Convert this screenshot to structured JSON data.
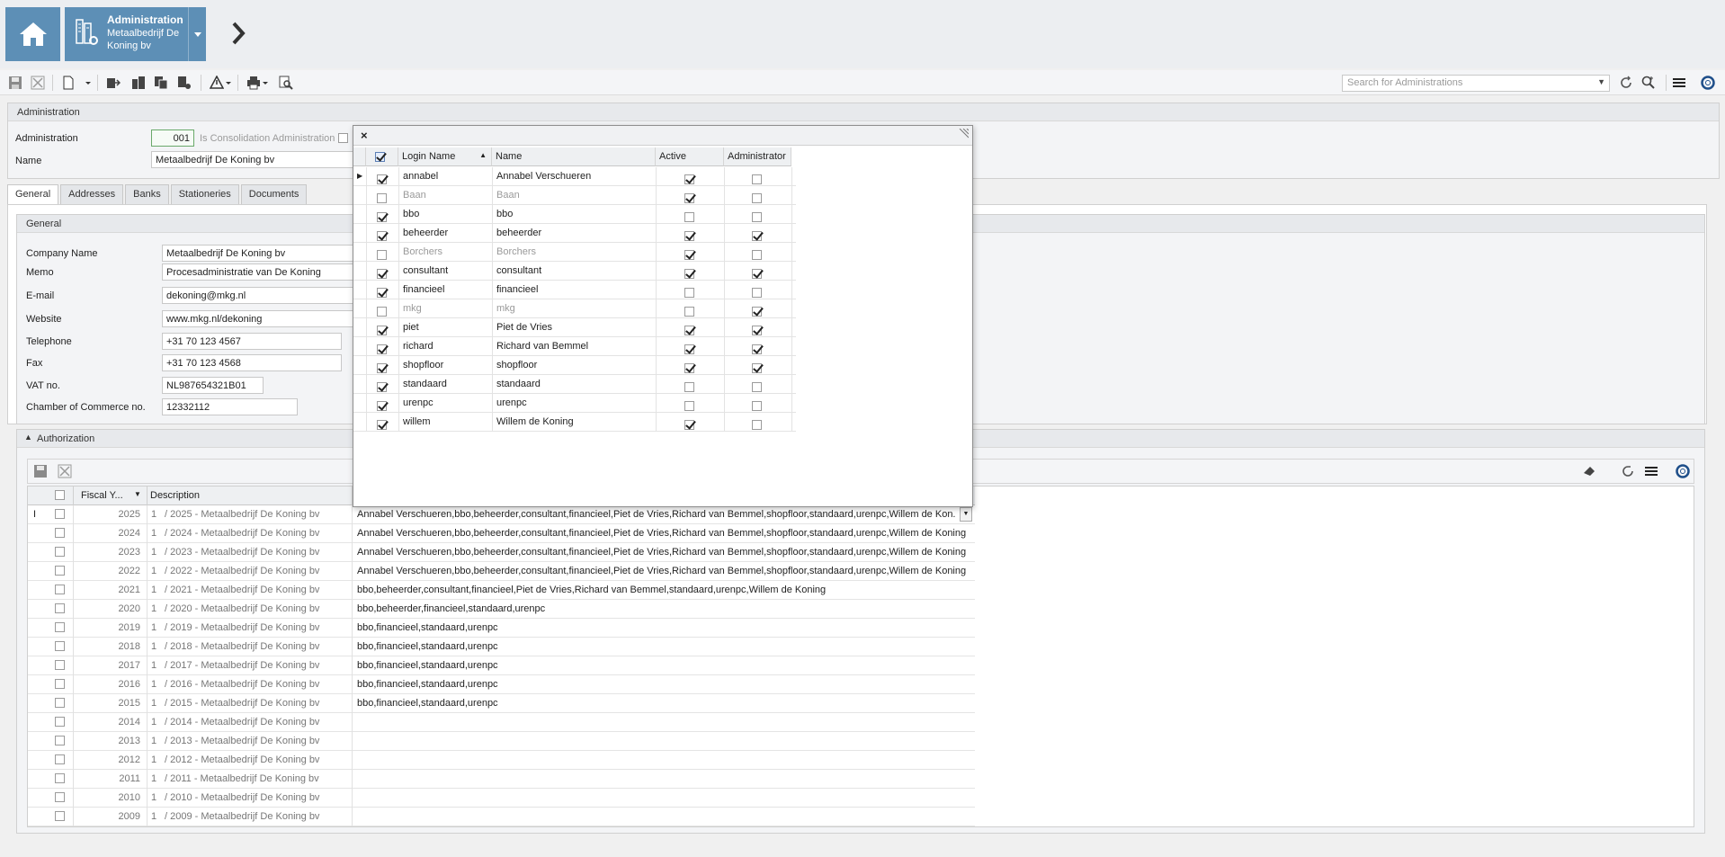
{
  "nav": {
    "title": "Administration",
    "subtitle": "Metaalbedrijf De Koning bv"
  },
  "search": {
    "placeholder": "Search for Administrations"
  },
  "admin_panel": {
    "header": "Administration",
    "administration_label": "Administration",
    "administration_value": "001",
    "consolidation_label": "Is Consolidation Administration",
    "name_label": "Name",
    "name_value": "Metaalbedrijf De Koning bv"
  },
  "tabs": [
    "General",
    "Addresses",
    "Banks",
    "Stationeries",
    "Documents"
  ],
  "general": {
    "header": "General",
    "fields": [
      {
        "label": "Company Name",
        "value": "Metaalbedrijf De Koning bv"
      },
      {
        "label": "Memo",
        "value": "Procesadministratie van De Koning"
      },
      {
        "label": "E-mail",
        "value": "dekoning@mkg.nl"
      },
      {
        "label": "Website",
        "value": "www.mkg.nl/dekoning"
      },
      {
        "label": "Telephone",
        "value": "+31 70 123 4567"
      },
      {
        "label": "Fax",
        "value": "+31 70 123 4568"
      },
      {
        "label": "VAT no.",
        "value": "NL987654321B01"
      },
      {
        "label": "Chamber of Commerce no.",
        "value": "12332112"
      }
    ]
  },
  "authorization": {
    "header": "Authorization",
    "columns": {
      "fiscal_year": "Fiscal Y...",
      "description": "Description"
    },
    "rows": [
      {
        "year": "2025",
        "num": "1",
        "desc": "/ 2025 - Metaalbedrijf De Koning bv",
        "users": "Annabel Verschueren,bbo,beheerder,consultant,financieel,Piet de Vries,Richard van Bemmel,shopfloor,standaard,urenpc,Willem de Kon..."
      },
      {
        "year": "2024",
        "num": "1",
        "desc": "/ 2024 - Metaalbedrijf De Koning bv",
        "users": "Annabel Verschueren,bbo,beheerder,consultant,financieel,Piet de Vries,Richard van Bemmel,shopfloor,standaard,urenpc,Willem de Koning"
      },
      {
        "year": "2023",
        "num": "1",
        "desc": "/ 2023 - Metaalbedrijf De Koning bv",
        "users": "Annabel Verschueren,bbo,beheerder,consultant,financieel,Piet de Vries,Richard van Bemmel,shopfloor,standaard,urenpc,Willem de Koning"
      },
      {
        "year": "2022",
        "num": "1",
        "desc": "/ 2022 - Metaalbedrijf De Koning bv",
        "users": "Annabel Verschueren,bbo,beheerder,consultant,financieel,Piet de Vries,Richard van Bemmel,shopfloor,standaard,urenpc,Willem de Koning"
      },
      {
        "year": "2021",
        "num": "1",
        "desc": "/ 2021 - Metaalbedrijf De Koning bv",
        "users": "bbo,beheerder,consultant,financieel,Piet de Vries,Richard van Bemmel,standaard,urenpc,Willem de Koning"
      },
      {
        "year": "2020",
        "num": "1",
        "desc": "/ 2020 - Metaalbedrijf De Koning bv",
        "users": "bbo,beheerder,financieel,standaard,urenpc"
      },
      {
        "year": "2019",
        "num": "1",
        "desc": "/ 2019 - Metaalbedrijf De Koning bv",
        "users": "bbo,financieel,standaard,urenpc"
      },
      {
        "year": "2018",
        "num": "1",
        "desc": "/ 2018 - Metaalbedrijf De Koning bv",
        "users": "bbo,financieel,standaard,urenpc"
      },
      {
        "year": "2017",
        "num": "1",
        "desc": "/ 2017 - Metaalbedrijf De Koning bv",
        "users": "bbo,financieel,standaard,urenpc"
      },
      {
        "year": "2016",
        "num": "1",
        "desc": "/ 2016 - Metaalbedrijf De Koning bv",
        "users": "bbo,financieel,standaard,urenpc"
      },
      {
        "year": "2015",
        "num": "1",
        "desc": "/ 2015 - Metaalbedrijf De Koning bv",
        "users": "bbo,financieel,standaard,urenpc"
      },
      {
        "year": "2014",
        "num": "1",
        "desc": "/ 2014 - Metaalbedrijf De Koning bv",
        "users": ""
      },
      {
        "year": "2013",
        "num": "1",
        "desc": "/ 2013 - Metaalbedrijf De Koning bv",
        "users": ""
      },
      {
        "year": "2012",
        "num": "1",
        "desc": "/ 2012 - Metaalbedrijf De Koning bv",
        "users": ""
      },
      {
        "year": "2011",
        "num": "1",
        "desc": "/ 2011 - Metaalbedrijf De Koning bv",
        "users": ""
      },
      {
        "year": "2010",
        "num": "1",
        "desc": "/ 2010 - Metaalbedrijf De Koning bv",
        "users": ""
      },
      {
        "year": "2009",
        "num": "1",
        "desc": "/ 2009 - Metaalbedrijf De Koning bv",
        "users": ""
      }
    ]
  },
  "popup": {
    "close_glyph": "×",
    "columns": {
      "login": "Login Name",
      "name": "Name",
      "active": "Active",
      "administrator": "Administrator"
    },
    "rows": [
      {
        "selected": true,
        "login": "annabel",
        "name": "Annabel Verschueren",
        "active": true,
        "admin": false
      },
      {
        "selected": false,
        "login": "Baan",
        "name": "Baan",
        "active": true,
        "admin": false
      },
      {
        "selected": true,
        "login": "bbo",
        "name": "bbo",
        "active": false,
        "admin": false
      },
      {
        "selected": true,
        "login": "beheerder",
        "name": "beheerder",
        "active": true,
        "admin": true
      },
      {
        "selected": false,
        "login": "Borchers",
        "name": "Borchers",
        "active": true,
        "admin": false
      },
      {
        "selected": true,
        "login": "consultant",
        "name": "consultant",
        "active": true,
        "admin": true
      },
      {
        "selected": true,
        "login": "financieel",
        "name": "financieel",
        "active": false,
        "admin": false
      },
      {
        "selected": false,
        "login": "mkg",
        "name": "mkg",
        "active": false,
        "admin": true
      },
      {
        "selected": true,
        "login": "piet",
        "name": "Piet de Vries",
        "active": true,
        "admin": true
      },
      {
        "selected": true,
        "login": "richard",
        "name": "Richard van Bemmel",
        "active": true,
        "admin": true
      },
      {
        "selected": true,
        "login": "shopfloor",
        "name": "shopfloor",
        "active": true,
        "admin": true
      },
      {
        "selected": true,
        "login": "standaard",
        "name": "standaard",
        "active": false,
        "admin": false
      },
      {
        "selected": true,
        "login": "urenpc",
        "name": "urenpc",
        "active": false,
        "admin": false
      },
      {
        "selected": true,
        "login": "willem",
        "name": "Willem de Koning",
        "active": true,
        "admin": false
      }
    ]
  },
  "colors": {
    "nav_tile": "#5d8fb6",
    "accent_field": "#6aa96a"
  }
}
